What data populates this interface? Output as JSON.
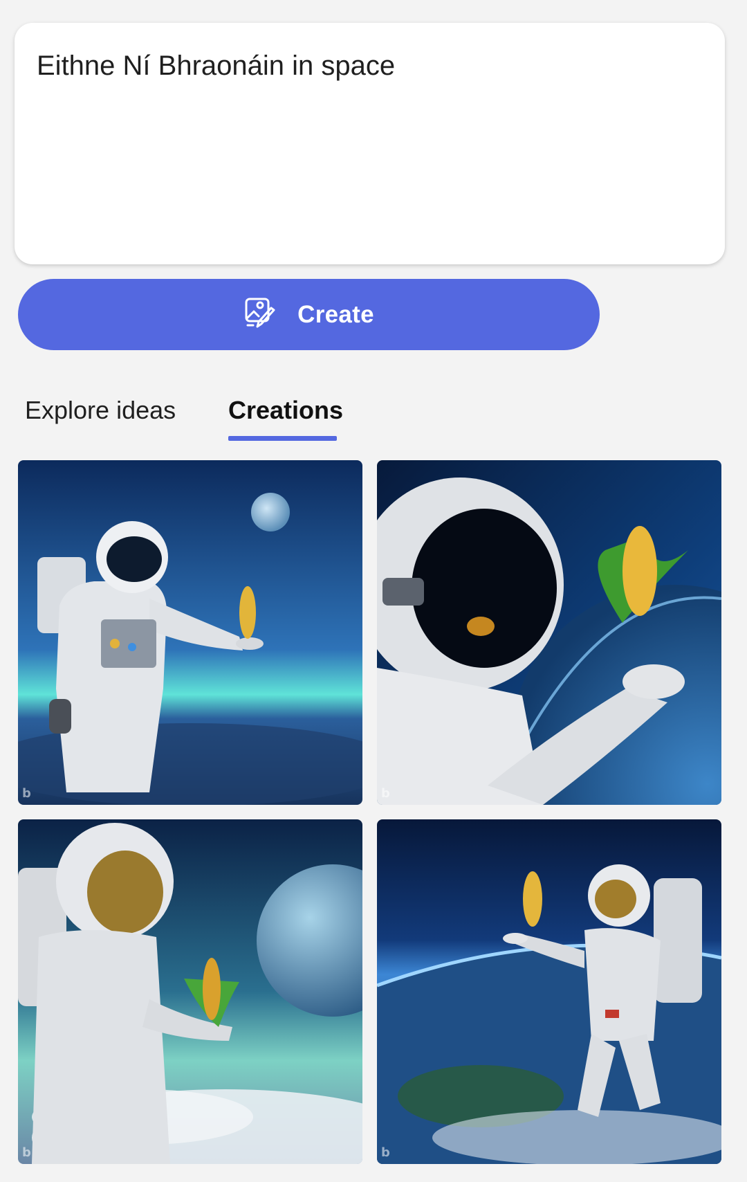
{
  "prompt": {
    "text": "Eithne Ní Bhraonáin in space"
  },
  "create_button": {
    "label": "Create",
    "icon": "image-create-icon",
    "color": "#5468e0"
  },
  "tabs": [
    {
      "label": "Explore ideas",
      "selected": false
    },
    {
      "label": "Creations",
      "selected": true
    }
  ],
  "creations": {
    "image_count": 4,
    "watermark_icon": "bing-logo-icon"
  }
}
